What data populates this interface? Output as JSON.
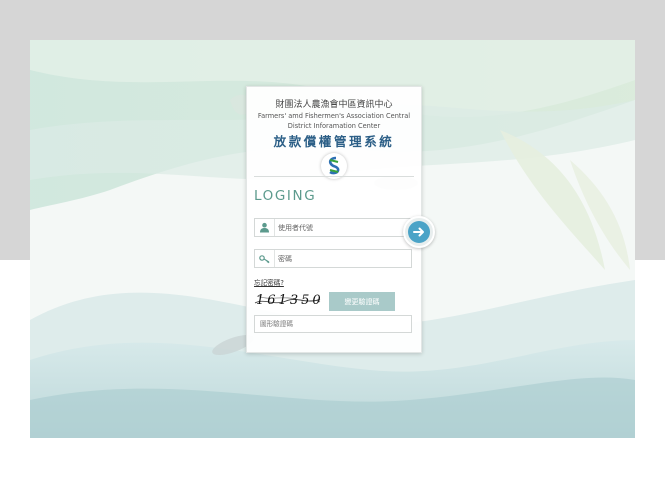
{
  "header": {
    "org_cn": "財團法人農漁會中區資訊中心",
    "org_en_line1": "Farmers' amd Fishermen's Association Central",
    "org_en_line2": "District Inforamation Center",
    "system_title": "放款償權管理系統"
  },
  "login": {
    "heading": "LOGING",
    "username_placeholder": "使用者代號",
    "password_placeholder": "密碼",
    "forgot_password": "忘記密碼?",
    "captcha_text": "161350",
    "refresh_captcha": "變更驗證碼",
    "captcha_placeholder": "圖形驗證碼"
  },
  "icons": {
    "user": "user-icon",
    "key": "key-icon",
    "submit": "arrow-right-icon",
    "logo": "association-logo"
  },
  "colors": {
    "title_blue": "#2c5f87",
    "heading_green": "#5c9a8d",
    "submit_blue": "#4ba3c7",
    "refresh_button": "#a9cac9"
  }
}
